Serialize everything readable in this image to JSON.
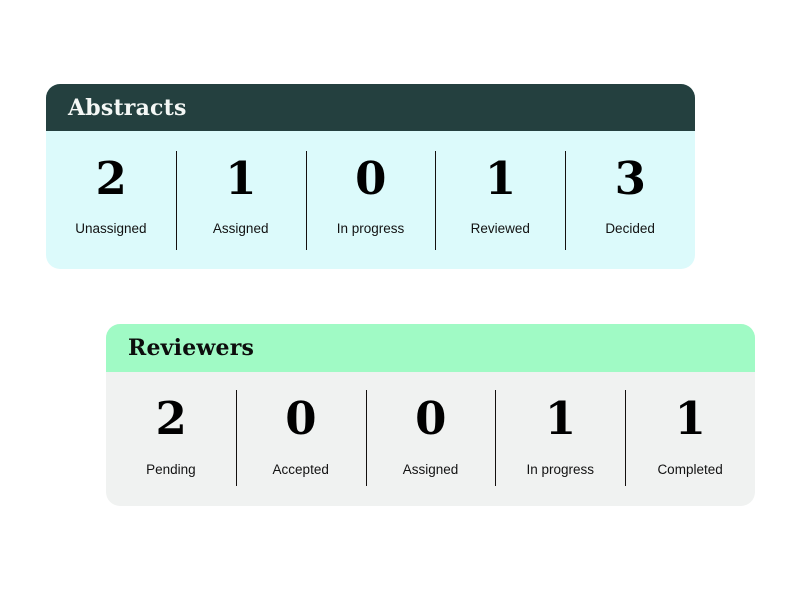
{
  "cards": [
    {
      "id": "abstracts",
      "title": "Abstracts",
      "header_bg": "#24403f",
      "header_text_color": "#f4f7f5",
      "body_bg": "#dcfafb",
      "stats": [
        {
          "value": "2",
          "label": "Unassigned"
        },
        {
          "value": "1",
          "label": "Assigned"
        },
        {
          "value": "0",
          "label": "In progress"
        },
        {
          "value": "1",
          "label": "Reviewed"
        },
        {
          "value": "3",
          "label": "Decided"
        }
      ]
    },
    {
      "id": "reviewers",
      "title": "Reviewers",
      "header_bg": "#a0fac5",
      "header_text_color": "#0d0d0d",
      "body_bg": "#f0f2f1",
      "stats": [
        {
          "value": "2",
          "label": "Pending"
        },
        {
          "value": "0",
          "label": "Accepted"
        },
        {
          "value": "0",
          "label": "Assigned"
        },
        {
          "value": "1",
          "label": "In progress"
        },
        {
          "value": "1",
          "label": "Completed"
        }
      ]
    }
  ]
}
